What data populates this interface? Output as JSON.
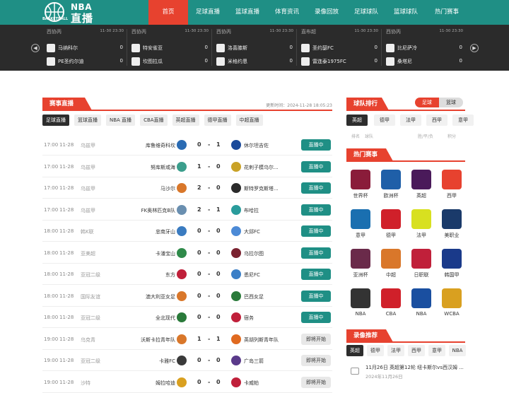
{
  "header": {
    "logo_top": "NBA",
    "logo_main": "直播",
    "logo_sub": "BASKETBALL",
    "nav": [
      "首页",
      "足球直播",
      "篮球直播",
      "体育资讯",
      "录像回放",
      "足球球队",
      "篮球球队",
      "热门赛事"
    ]
  },
  "scores": [
    {
      "league": "西协丙",
      "time": "11-30 23:30",
      "home": "马纳科尔",
      "home_score": "0",
      "away": "PE圣约尔迪",
      "away_score": "0"
    },
    {
      "league": "西协丙",
      "time": "11-30 23:30",
      "home": "特安雀亚",
      "home_score": "0",
      "away": "坎图拉瓜",
      "away_score": "0"
    },
    {
      "league": "西协丙",
      "time": "11-30 23:30",
      "home": "洛喜膝斯",
      "home_score": "0",
      "away": "米格约恩",
      "away_score": "0"
    },
    {
      "league": "直布超",
      "time": "11-30 23:30",
      "home": "圣约瑟FC",
      "home_score": "0",
      "away": "雷连泰1975FC",
      "away_score": "0"
    },
    {
      "league": "西协丙",
      "time": "11-30 23:30",
      "home": "比尼萨冷",
      "home_score": "0",
      "away": "桑塔尼",
      "away_score": "0"
    }
  ],
  "live": {
    "title": "赛事直播",
    "updated": "更新时间：2024-11-28 18:05:23",
    "tabs": [
      "足球直播",
      "篮球直播",
      "NBA 直播",
      "CBA直播",
      "英超直播",
      "德甲直播",
      "中超直播"
    ],
    "matches": [
      {
        "time": "17:00",
        "date": "11-28",
        "league": "乌兹甲",
        "home": "库鲁维奇科坎",
        "hs": "0",
        "as": "1",
        "away": "休尔坦吉佐",
        "status": "直播中",
        "hc": "#2a6bb3",
        "ac": "#1b4a9a"
      },
      {
        "time": "17:00",
        "date": "11-28",
        "league": "乌兹甲",
        "home": "努库斯咸海",
        "hs": "1",
        "as": "0",
        "away": "花剌子模乌尔...",
        "status": "直播中",
        "hc": "#3b9e8c",
        "ac": "#c9a227"
      },
      {
        "time": "17:00",
        "date": "11-28",
        "league": "乌兹甲",
        "home": "马沙尔",
        "hs": "2",
        "as": "0",
        "away": "斯特罗克斯塔...",
        "status": "直播中",
        "hc": "#d9772a",
        "ac": "#2a2a2a"
      },
      {
        "time": "17:00",
        "date": "11-28",
        "league": "乌兹甲",
        "home": "FK奥林匹克B队",
        "hs": "2",
        "as": "1",
        "away": "布哈拉",
        "status": "直播中",
        "hc": "#6a8fb0",
        "ac": "#2a9c9c"
      },
      {
        "time": "18:00",
        "date": "11-28",
        "league": "韩K联",
        "home": "忠南牙山",
        "hs": "0",
        "as": "0",
        "away": "大邱FC",
        "status": "直播中",
        "hc": "#3a7bc0",
        "ac": "#4c8ad6"
      },
      {
        "time": "18:00",
        "date": "11-28",
        "league": "亚美超",
        "home": "卡潘宝山",
        "hs": "0",
        "as": "0",
        "away": "乌拉尔图",
        "status": "直播中",
        "hc": "#2f8a4a",
        "ac": "#7a2230"
      },
      {
        "time": "18:00",
        "date": "11-28",
        "league": "亚冠二级",
        "home": "东方",
        "hs": "0",
        "as": "0",
        "away": "悉尼FC",
        "status": "直播中",
        "hc": "#c0203a",
        "ac": "#3b7fc7"
      },
      {
        "time": "18:00",
        "date": "11-28",
        "league": "国际友谊",
        "home": "澳大利亚女足",
        "hs": "0",
        "as": "0",
        "away": "巴西女足",
        "status": "直播中",
        "hc": "#d9772a",
        "ac": "#2a7a3a"
      },
      {
        "time": "18:00",
        "date": "11-28",
        "league": "亚冠二级",
        "home": "全北现代",
        "hs": "0",
        "as": "0",
        "away": "宿务",
        "status": "直播中",
        "hc": "#2a7a3a",
        "ac": "#c0203a"
      },
      {
        "time": "19:00",
        "date": "11-28",
        "league": "乌克青",
        "home": "沃斯卡拉青年队",
        "hs": "1",
        "as": "1",
        "away": "英胡列斯青年队",
        "status": "即将开始",
        "hc": "#d9772a",
        "ac": "#e06a20"
      },
      {
        "time": "19:00",
        "date": "11-28",
        "league": "亚冠二级",
        "home": "卡雅FC",
        "hs": "0",
        "as": "0",
        "away": "广岛三箭",
        "status": "即将开始",
        "hc": "#3a3a3a",
        "ac": "#5a3a8a"
      },
      {
        "time": "19:00",
        "date": "11-28",
        "league": "沙特",
        "home": "姆拉哈迪",
        "hs": "0",
        "as": "0",
        "away": "卡威帕",
        "status": "即将开始",
        "hc": "#d9a020",
        "ac": "#c0203a"
      }
    ]
  },
  "rank": {
    "title": "球队排行",
    "switch": [
      "足球",
      "篮球"
    ],
    "tabs": [
      "英超",
      "德甲",
      "法甲",
      "西甲",
      "意甲"
    ],
    "cols": [
      "排名",
      "球队",
      "胜/平/负",
      "积分"
    ]
  },
  "hot": {
    "title": "热门赛事",
    "items": [
      {
        "name": "世界杯",
        "color": "#8a1c3a"
      },
      {
        "name": "欧洲杯",
        "color": "#1f5fa8"
      },
      {
        "name": "英超",
        "color": "#4a1a5a"
      },
      {
        "name": "西甲",
        "color": "#e7422f"
      },
      {
        "name": "意甲",
        "color": "#1a6fb0"
      },
      {
        "name": "德甲",
        "color": "#d0202a"
      },
      {
        "name": "法甲",
        "color": "#d8e020"
      },
      {
        "name": "美职业",
        "color": "#1a3a6a"
      },
      {
        "name": "亚洲杯",
        "color": "#6a2a4a"
      },
      {
        "name": "中超",
        "color": "#d9772a"
      },
      {
        "name": "日职联",
        "color": "#c0203a"
      },
      {
        "name": "韩国甲",
        "color": "#1a3a8a"
      },
      {
        "name": "NBA",
        "color": "#333333"
      },
      {
        "name": "CBA",
        "color": "#d0202a"
      },
      {
        "name": "NBA",
        "color": "#1a4fa0"
      },
      {
        "name": "WCBA",
        "color": "#d9a020"
      }
    ]
  },
  "video": {
    "title": "录像推荐",
    "tabs": [
      "英超",
      "德甲",
      "法甲",
      "西甲",
      "意甲",
      "NBA"
    ],
    "items": [
      {
        "title": "11月26日 英超第12轮 纽卡斯尔vs西汉姆 ...",
        "date": "2024年11月26日"
      }
    ]
  }
}
